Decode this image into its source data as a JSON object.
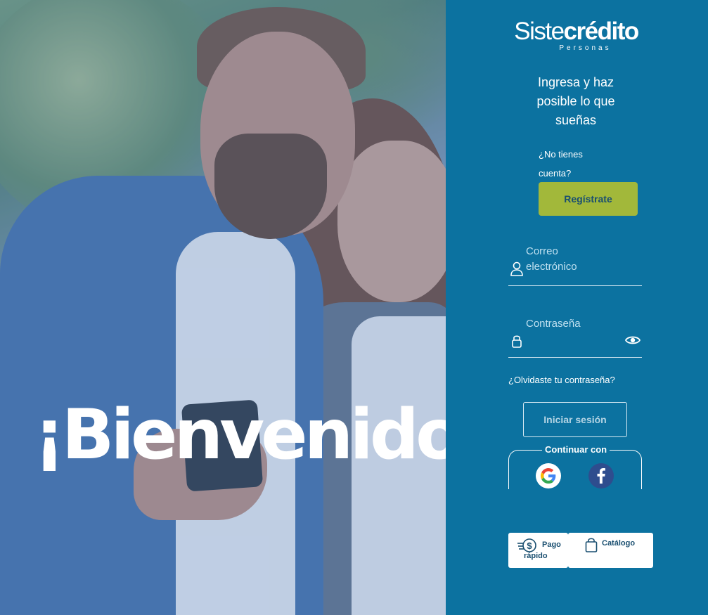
{
  "hero": {
    "welcome_text": "¡Bienvenido!"
  },
  "brand": {
    "name_light": "Siste",
    "name_bold": "crédito",
    "subtitle": "Personas"
  },
  "tagline": "Ingresa y haz posible lo que sueñas",
  "signup": {
    "prompt": "¿No tienes cuenta?",
    "button_label": "Regístrate"
  },
  "login_form": {
    "email_label": "Correo electrónico",
    "email_value": "",
    "password_label": "Contraseña",
    "password_value": "",
    "forgot_link": "¿Olvidaste tu contraseña?",
    "submit_label": "Iniciar sesión"
  },
  "social_login": {
    "label": "Continuar con",
    "providers": [
      "google-icon",
      "facebook-icon"
    ]
  },
  "quick_links": {
    "pay_label": "Pago rápido",
    "catalog_label": "Catálogo"
  },
  "colors": {
    "panel_bg": "#0c72a0",
    "accent_green": "#a2b83a",
    "text_dark": "#1a4f70"
  }
}
